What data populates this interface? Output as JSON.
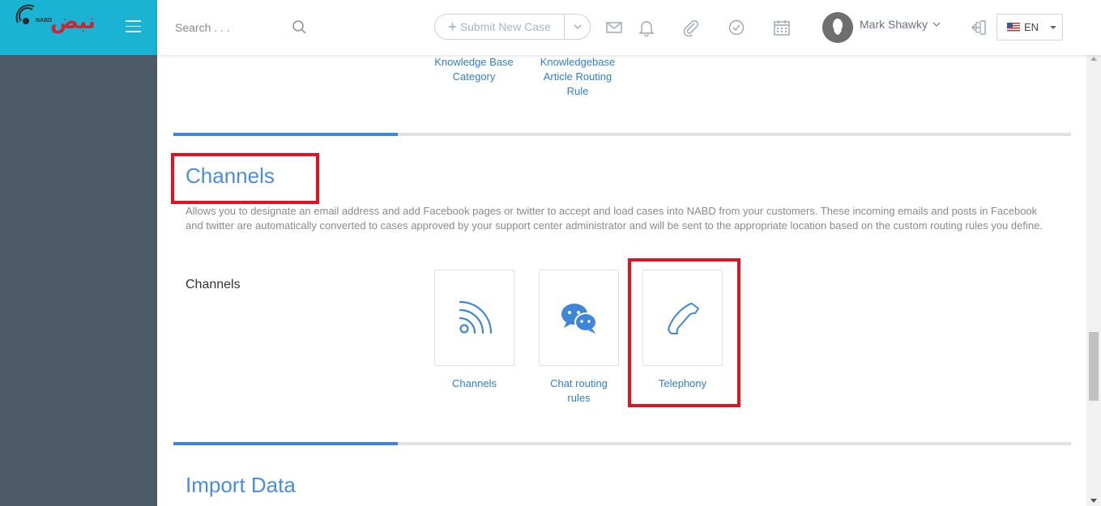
{
  "app": {
    "logo_text": "نبض",
    "logo_sub": "NABD"
  },
  "header": {
    "search_placeholder": "Search . . .",
    "submit_label": "Submit New Case",
    "user_name": "Mark Shawky",
    "language": "EN"
  },
  "knowledge_tiles": [
    {
      "label": "Knowledge Base Category"
    },
    {
      "label": "Knowledgebase Article Routing Rule"
    }
  ],
  "channels_section": {
    "title": "Channels",
    "description": "Allows you to designate an email address and add Facebook pages or twitter to accept and load cases into NABD from your customers. These incoming emails and posts in Facebook and twitter are automatically converted to cases approved by your support center administrator and will be sent to the appropriate location based on the custom routing rules you define.",
    "group_label": "Channels",
    "tiles": [
      {
        "label": "Channels",
        "icon": "rss-icon"
      },
      {
        "label": "Chat routing rules",
        "icon": "chat-bubbles-icon"
      },
      {
        "label": "Telephony",
        "icon": "phone-icon"
      }
    ]
  },
  "import_section": {
    "title": "Import Data"
  },
  "colors": {
    "sidebar": "#4c5a67",
    "logo_bar": "#1ab3d3",
    "accent": "#3f86d8",
    "link": "#2f7fce",
    "highlight": "#e0141e"
  }
}
